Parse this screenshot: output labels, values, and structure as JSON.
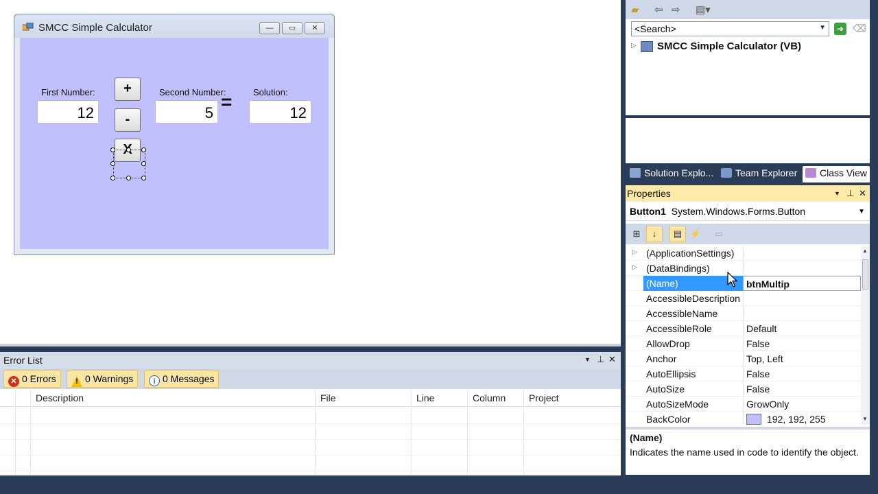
{
  "form": {
    "title": "SMCC Simple Calculator",
    "min_label": "—",
    "max_label": "▭",
    "close_label": "✕",
    "first_label": "First Number:",
    "first_value": "12",
    "second_label": "Second Number:",
    "second_value": "5",
    "solution_label": "Solution:",
    "solution_value": "12",
    "plus_label": "+",
    "minus_label": "-",
    "multiply_label": "X",
    "equals": "=",
    "client_color": "#c0c0ff"
  },
  "error_list": {
    "title": "Error List",
    "errors": "0 Errors",
    "warnings": "0 Warnings",
    "messages": "0 Messages",
    "columns": [
      "Description",
      "File",
      "Line",
      "Column",
      "Project"
    ]
  },
  "class_view": {
    "search_placeholder": "<Search>",
    "tree_root": "SMCC Simple Calculator (VB)"
  },
  "tabs": [
    "Solution Explo...",
    "Team Explorer",
    "Class View"
  ],
  "properties": {
    "title": "Properties",
    "object_name": "Button1",
    "object_type": "System.Windows.Forms.Button",
    "rows": [
      {
        "name": "(ApplicationSettings)",
        "value": "",
        "expandable": true
      },
      {
        "name": "(DataBindings)",
        "value": "",
        "expandable": true
      },
      {
        "name": "(Name)",
        "value": "btnMultip",
        "selected": true
      },
      {
        "name": "AccessibleDescription",
        "value": ""
      },
      {
        "name": "AccessibleName",
        "value": ""
      },
      {
        "name": "AccessibleRole",
        "value": "Default"
      },
      {
        "name": "AllowDrop",
        "value": "False"
      },
      {
        "name": "Anchor",
        "value": "Top, Left"
      },
      {
        "name": "AutoEllipsis",
        "value": "False"
      },
      {
        "name": "AutoSize",
        "value": "False"
      },
      {
        "name": "AutoSizeMode",
        "value": "GrowOnly"
      },
      {
        "name": "BackColor",
        "value": "192, 192, 255",
        "swatch": "#c0c0ff"
      }
    ],
    "desc_name": "(Name)",
    "desc_text": "Indicates the name used in code to identify the object."
  },
  "colors": {
    "accent_selection": "#3399ff",
    "ide_background": "#2b3c59",
    "filter_highlight": "#fbe6a6"
  }
}
